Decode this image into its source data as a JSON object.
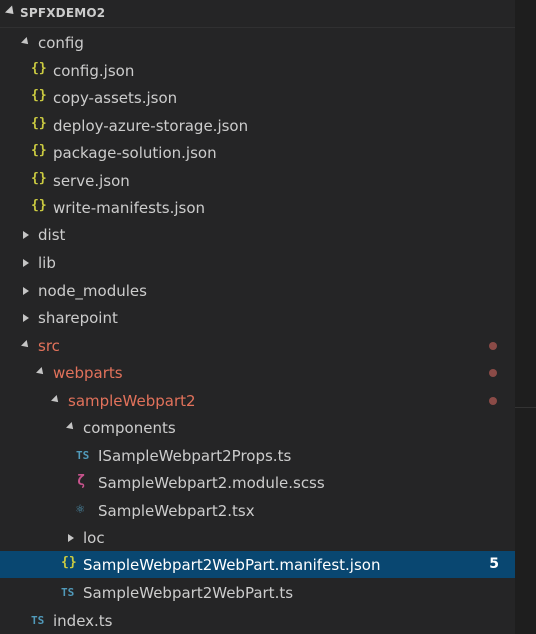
{
  "explorer": {
    "title": "SPFXDEMO2",
    "items": [
      {
        "label": "config",
        "kind": "folder",
        "state": "open",
        "level": 1
      },
      {
        "label": "config.json",
        "kind": "json",
        "level": 2,
        "icon": "json-braces-icon"
      },
      {
        "label": "copy-assets.json",
        "kind": "json",
        "level": 2,
        "icon": "json-braces-icon"
      },
      {
        "label": "deploy-azure-storage.json",
        "kind": "json",
        "level": 2,
        "icon": "json-braces-icon"
      },
      {
        "label": "package-solution.json",
        "kind": "json",
        "level": 2,
        "icon": "json-braces-icon"
      },
      {
        "label": "serve.json",
        "kind": "json",
        "level": 2,
        "icon": "json-braces-icon"
      },
      {
        "label": "write-manifests.json",
        "kind": "json",
        "level": 2,
        "icon": "json-braces-icon"
      },
      {
        "label": "dist",
        "kind": "folder",
        "state": "closed",
        "level": 1
      },
      {
        "label": "lib",
        "kind": "folder",
        "state": "closed",
        "level": 1
      },
      {
        "label": "node_modules",
        "kind": "folder",
        "state": "closed",
        "level": 1
      },
      {
        "label": "sharepoint",
        "kind": "folder",
        "state": "closed",
        "level": 1
      },
      {
        "label": "src",
        "kind": "folder",
        "state": "open",
        "level": 1,
        "modified": true
      },
      {
        "label": "webparts",
        "kind": "folder",
        "state": "open",
        "level": 2,
        "modified": true
      },
      {
        "label": "sampleWebpart2",
        "kind": "folder",
        "state": "open",
        "level": 3,
        "modified": true
      },
      {
        "label": "components",
        "kind": "folder",
        "state": "open",
        "level": 4
      },
      {
        "label": "ISampleWebpart2Props.ts",
        "kind": "ts",
        "level": 5,
        "icon": "typescript-icon",
        "icon_text": "TS"
      },
      {
        "label": "SampleWebpart2.module.scss",
        "kind": "scss",
        "level": 5,
        "icon": "sass-icon"
      },
      {
        "label": "SampleWebpart2.tsx",
        "kind": "react",
        "level": 5,
        "icon": "react-icon"
      },
      {
        "label": "loc",
        "kind": "folder",
        "state": "closed",
        "level": 4
      },
      {
        "label": "SampleWebpart2WebPart.manifest.json",
        "kind": "json",
        "level": 4,
        "icon": "json-braces-icon",
        "selected": true,
        "badge": "5"
      },
      {
        "label": "SampleWebpart2WebPart.ts",
        "kind": "ts",
        "level": 4,
        "icon": "typescript-icon",
        "icon_text": "TS"
      },
      {
        "label": "index.ts",
        "kind": "ts",
        "level": 2,
        "icon": "typescript-icon",
        "icon_text": "TS"
      }
    ]
  },
  "colors": {
    "background": "#252526",
    "selected_row": "#094771",
    "modified_text": "#e2725b",
    "modified_dot": "#8b4b47",
    "json_icon": "#cbcb41",
    "ts_icon": "#519aba",
    "scss_icon": "#c6538c"
  }
}
